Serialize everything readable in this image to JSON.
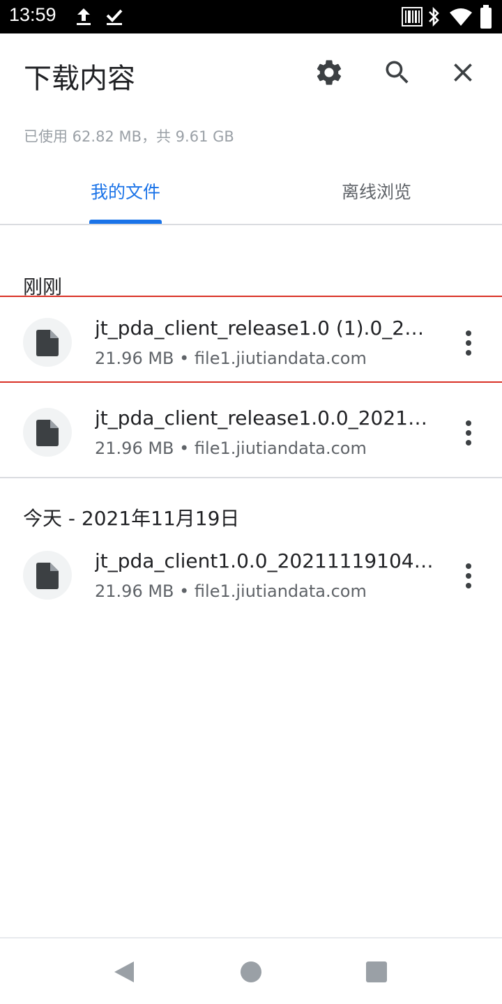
{
  "status_bar": {
    "time": "13:59",
    "icons": [
      "upload-icon",
      "download-done-icon",
      "barcode-scanner-icon",
      "bluetooth-icon",
      "wifi-icon",
      "battery-icon"
    ]
  },
  "toolbar": {
    "title": "下载内容",
    "settings_icon": "gear-icon",
    "search_icon": "search-icon",
    "close_icon": "close-icon"
  },
  "storage": {
    "text": "已使用 62.82 MB，共 9.61 GB"
  },
  "tabs": [
    {
      "label": "我的文件",
      "active": true
    },
    {
      "label": "离线浏览",
      "active": false
    }
  ],
  "colors": {
    "accent": "#1a73e8",
    "selection_border": "#d93025",
    "text_primary": "#202124",
    "text_secondary": "#5f6368"
  },
  "sections": [
    {
      "header": "刚刚",
      "items": [
        {
          "name": "jt_pda_client_release1.0 (1).0_20…",
          "meta": "21.96 MB • file1.jiutiandata.com",
          "selected": true
        },
        {
          "name": "jt_pda_client_release1.0.0_2021…",
          "meta": "21.96 MB • file1.jiutiandata.com",
          "selected": false
        }
      ]
    },
    {
      "header": "今天 - 2021年11月19日",
      "items": [
        {
          "name": "jt_pda_client1.0.0_20211119104…",
          "meta": "21.96 MB • file1.jiutiandata.com",
          "selected": false
        }
      ]
    }
  ],
  "nav_bar": {
    "icons": [
      "back-icon",
      "home-icon",
      "recents-icon"
    ]
  }
}
